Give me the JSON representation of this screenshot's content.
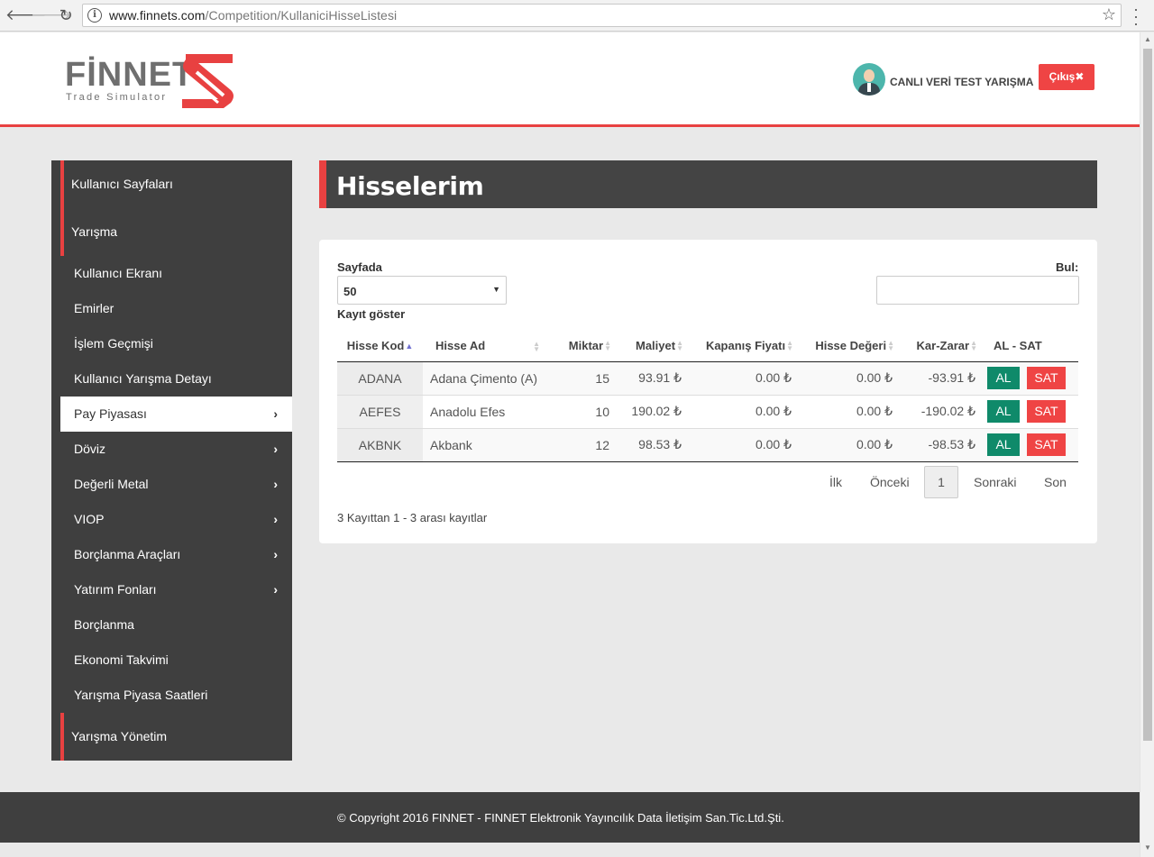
{
  "browser": {
    "url_host": "www.finnets.com",
    "url_path": "/Competition/KullaniciHisseListesi"
  },
  "header": {
    "logo_text": "FİNNET",
    "logo_sub": "Trade Simulator",
    "user_name": "CANLI VERİ TEST YARIŞMA",
    "logout_label": "Çıkış",
    "accent": "#e84141"
  },
  "sidebar": {
    "section1": "Kullanıcı Sayfaları",
    "section2": "Yarışma",
    "items": [
      {
        "label": "Kullanıcı Ekranı"
      },
      {
        "label": "Emirler"
      },
      {
        "label": "İşlem Geçmişi"
      },
      {
        "label": "Kullanıcı Yarışma Detayı"
      },
      {
        "label": "Pay Piyasası"
      },
      {
        "label": "Döviz"
      },
      {
        "label": "Değerli Metal"
      },
      {
        "label": "VIOP"
      },
      {
        "label": "Borçlanma Araçları"
      },
      {
        "label": "Yatırım Fonları"
      },
      {
        "label": "Borçlanma"
      },
      {
        "label": "Ekonomi Takvimi"
      },
      {
        "label": "Yarışma Piyasa Saatleri"
      }
    ],
    "section3": "Yarışma Yönetim"
  },
  "page": {
    "title": "Hisselerim",
    "page_size_label": "Sayfada",
    "page_size_value": "50",
    "show_records_label": "Kayıt göster",
    "search_label": "Bul:"
  },
  "table": {
    "headers": {
      "code": "Hisse Kod",
      "name": "Hisse Ad",
      "qty": "Miktar",
      "cost": "Maliyet",
      "close": "Kapanış Fiyatı",
      "value": "Hisse Değeri",
      "pnl": "Kar-Zarar",
      "actions": "AL - SAT"
    },
    "rows": [
      {
        "code": "ADANA",
        "name": "Adana Çimento (A)",
        "qty": "15",
        "cost": "93.91 ₺",
        "close": "0.00 ₺",
        "value": "0.00 ₺",
        "pnl": "-93.91 ₺"
      },
      {
        "code": "AEFES",
        "name": "Anadolu Efes",
        "qty": "10",
        "cost": "190.02 ₺",
        "close": "0.00 ₺",
        "value": "0.00 ₺",
        "pnl": "-190.02 ₺"
      },
      {
        "code": "AKBNK",
        "name": "Akbank",
        "qty": "12",
        "cost": "98.53 ₺",
        "close": "0.00 ₺",
        "value": "0.00 ₺",
        "pnl": "-98.53 ₺"
      }
    ],
    "buy_label": "AL",
    "sell_label": "SAT"
  },
  "pagination": {
    "first": "İlk",
    "prev": "Önceki",
    "current": "1",
    "next": "Sonraki",
    "last": "Son",
    "info": "3 Kayıttan 1 - 3 arası kayıtlar"
  },
  "footer": {
    "copyright": "© Copyright 2016 FINNET - FINNET Elektronik Yayıncılık Data İletişim San.Tic.Ltd.Şti."
  }
}
